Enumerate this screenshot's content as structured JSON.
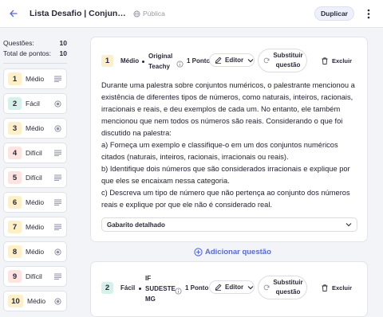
{
  "header": {
    "title": "Lista Desafio | Conjuntos Numéricos",
    "visibility": "Pública",
    "duplicate_label": "Duplicar"
  },
  "sidebar": {
    "questions_label": "Questões:",
    "questions_count": "10",
    "points_label": "Total de pontos:",
    "points_count": "10",
    "items": [
      {
        "number": "1",
        "difficulty": "Médio",
        "color": "#fdf0c8",
        "type_icon": "text-lines-icon"
      },
      {
        "number": "2",
        "difficulty": "Fácil",
        "color": "#d6f1ea",
        "type_icon": "radio-icon"
      },
      {
        "number": "3",
        "difficulty": "Médio",
        "color": "#fdf0c8",
        "type_icon": "radio-icon"
      },
      {
        "number": "4",
        "difficulty": "Difícil",
        "color": "#fde4e1",
        "type_icon": "text-lines-icon"
      },
      {
        "number": "5",
        "difficulty": "Difícil",
        "color": "#fde4e1",
        "type_icon": "text-lines-icon"
      },
      {
        "number": "6",
        "difficulty": "Médio",
        "color": "#fdf0c8",
        "type_icon": "text-lines-icon"
      },
      {
        "number": "7",
        "difficulty": "Médio",
        "color": "#fdf0c8",
        "type_icon": "text-lines-icon"
      },
      {
        "number": "8",
        "difficulty": "Médio",
        "color": "#fdf0c8",
        "type_icon": "radio-icon"
      },
      {
        "number": "9",
        "difficulty": "Difícil",
        "color": "#fde4e1",
        "type_icon": "text-lines-icon"
      },
      {
        "number": "10",
        "difficulty": "Médio",
        "color": "#fdf0c8",
        "type_icon": "radio-icon"
      }
    ]
  },
  "questions": [
    {
      "number": "1",
      "difficulty": "Médio",
      "source_line1": "Original",
      "source_line2": "Teachy",
      "points": "1 Ponto",
      "editor_label": "Editor",
      "replace_line1": "Substituir",
      "replace_line2": "questão",
      "delete_label": "Excluir",
      "color": "#fdf0c8",
      "text": [
        "Durante uma palestra sobre conjuntos numéricos, o palestrante mencionou a existência de diferentes tipos de números, como naturais, inteiros, racionais, irracionais e reais, e deu exemplos de cada um. No entanto, ele também mencionou que nem todos os números são reais. Considerando o que foi discutido na palestra:",
        "a) Forneça um exemplo e classifique-o em um dos conjuntos numéricos citados (naturais, inteiros, racionais, irracionais ou reais).",
        "b) Identifique dois números que são considerados irracionais e explique por que eles se encaixam nessa categoria.",
        "c) Descreva um tipo de número que não pertença ao conjunto dos números reais e explique por que ele não é considerado real."
      ],
      "answer_label": "Gabarito detalhado"
    },
    {
      "number": "2",
      "difficulty": "Fácil",
      "source_line1": "IF",
      "source_line2": "SUDESTE",
      "source_line3": "MG",
      "points": "1 Ponto",
      "editor_label": "Editor",
      "replace_line1": "Substituir",
      "replace_line2": "questão",
      "delete_label": "Excluir",
      "color": "#d6f1ea"
    }
  ],
  "add_question_label": "Adicionar questão",
  "colors": {
    "accent": "#5b6ad0",
    "medium": "#fdf0c8",
    "easy": "#d6f1ea",
    "hard": "#fde4e1"
  }
}
